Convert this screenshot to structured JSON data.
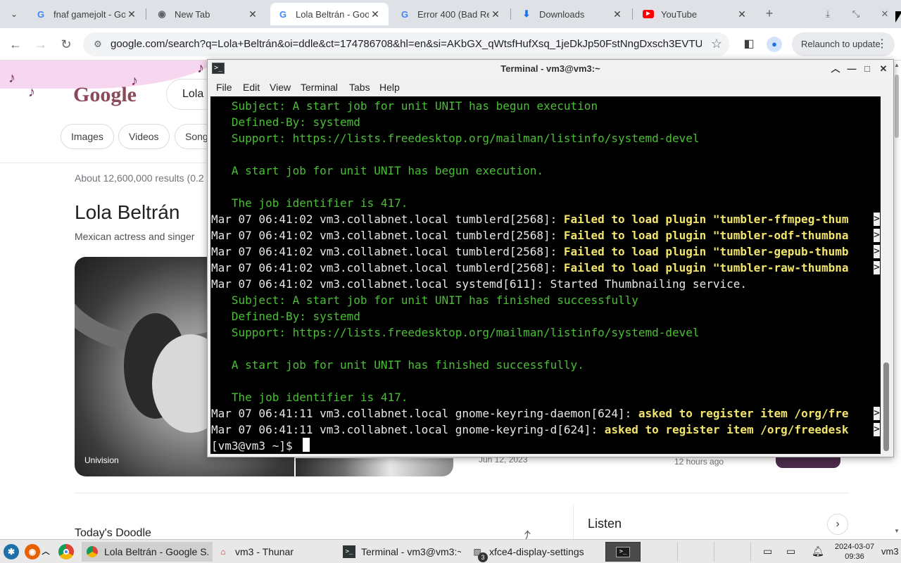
{
  "browser": {
    "tabs": [
      {
        "title": "fnaf gamejolt - Go",
        "icon": "google-icon"
      },
      {
        "title": "New Tab",
        "icon": "chrome-icon"
      },
      {
        "title": "Lola Beltrán - Goo",
        "icon": "google-icon"
      },
      {
        "title": "Error 400 (Bad Re",
        "icon": "google-icon"
      },
      {
        "title": "Downloads",
        "icon": "download-icon"
      },
      {
        "title": "YouTube",
        "icon": "youtube-icon"
      }
    ],
    "active_tab_index": 2,
    "url": "google.com/search?q=Lola+Beltrán&oi=ddle&ct=174786708&hl=en&si=AKbGX_qWtsfHufXsq_1jeDkJp50FstNngDxsch3EVTUjn...",
    "relaunch_label": "Relaunch to update"
  },
  "google": {
    "logo": "Google",
    "query": "Lola",
    "chips": [
      "Images",
      "Videos",
      "Song"
    ],
    "results_count": "About 12,600,000 results (0.2",
    "kp_title": "Lola Beltrán",
    "kp_subtitle": "Mexican actress and singer",
    "photo_caption": "Univision",
    "date_a": "Jun 12, 2023",
    "date_b": "12 hours ago",
    "todays_doodle": "Today's Doodle",
    "listen": "Listen"
  },
  "terminal": {
    "title": "Terminal - vm3@vm3:~",
    "menu": [
      "File",
      "Edit",
      "View",
      "Terminal",
      "Tabs",
      "Help"
    ],
    "lines": [
      {
        "type": "green",
        "text": "   Subject: A start job for unit UNIT has begun execution"
      },
      {
        "type": "green",
        "text": "   Defined-By: systemd"
      },
      {
        "type": "green",
        "text": "   Support: https://lists.freedesktop.org/mailman/listinfo/systemd-devel"
      },
      {
        "type": "green",
        "text": ""
      },
      {
        "type": "green",
        "text": "   A start job for unit UNIT has begun execution."
      },
      {
        "type": "green",
        "text": ""
      },
      {
        "type": "green",
        "text": "   The job identifier is 417."
      },
      {
        "type": "log",
        "prefix": "Mar 07 06:41:02 vm3.collabnet.local tumblerd[2568]: ",
        "highlight": "Failed to load plugin \"tumbler-ffmpeg-thum",
        "cut": true
      },
      {
        "type": "log",
        "prefix": "Mar 07 06:41:02 vm3.collabnet.local tumblerd[2568]: ",
        "highlight": "Failed to load plugin \"tumbler-odf-thumbna",
        "cut": true
      },
      {
        "type": "log",
        "prefix": "Mar 07 06:41:02 vm3.collabnet.local tumblerd[2568]: ",
        "highlight": "Failed to load plugin \"tumbler-gepub-thumb",
        "cut": true
      },
      {
        "type": "log",
        "prefix": "Mar 07 06:41:02 vm3.collabnet.local tumblerd[2568]: ",
        "highlight": "Failed to load plugin \"tumbler-raw-thumbna",
        "cut": true
      },
      {
        "type": "plain",
        "text": "Mar 07 06:41:02 vm3.collabnet.local systemd[611]: Started Thumbnailing service."
      },
      {
        "type": "green",
        "text": "   Subject: A start job for unit UNIT has finished successfully"
      },
      {
        "type": "green",
        "text": "   Defined-By: systemd"
      },
      {
        "type": "green",
        "text": "   Support: https://lists.freedesktop.org/mailman/listinfo/systemd-devel"
      },
      {
        "type": "green",
        "text": ""
      },
      {
        "type": "green",
        "text": "   A start job for unit UNIT has finished successfully."
      },
      {
        "type": "green",
        "text": ""
      },
      {
        "type": "green",
        "text": "   The job identifier is 417."
      },
      {
        "type": "log",
        "prefix": "Mar 07 06:41:11 vm3.collabnet.local gnome-keyring-daemon[624]: ",
        "highlight": "asked to register item /org/fre",
        "cut": true
      },
      {
        "type": "log",
        "prefix": "Mar 07 06:41:11 vm3.collabnet.local gnome-keyring-d[624]: ",
        "highlight": "asked to register item /org/freedesk",
        "cut": true
      },
      {
        "type": "plain",
        "text": "[vm3@vm3 ~]$ "
      }
    ],
    "cut_marker": ">"
  },
  "taskbar": {
    "tasks": [
      {
        "label": "Lola Beltrán - Google S...",
        "icon": "chrome-icon"
      },
      {
        "label": "vm3 - Thunar",
        "icon": "home-folder-icon"
      },
      {
        "label": "Terminal - vm3@vm3:~",
        "icon": "terminal-icon"
      },
      {
        "label": "xfce4-display-settings",
        "icon": "display-settings-icon"
      }
    ],
    "badge_count": "3",
    "clock_date": "2024-03-07",
    "clock_time": "09:36",
    "user": "vm3"
  }
}
